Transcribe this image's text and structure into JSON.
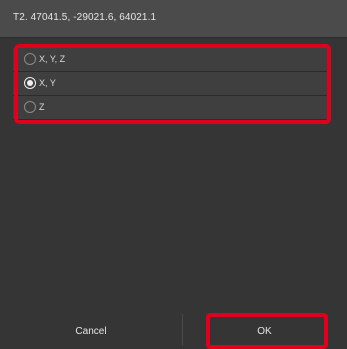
{
  "dialog": {
    "title": "T2. 47041.5, -29021.6, 64021.1"
  },
  "options": [
    {
      "label": "X, Y, Z",
      "selected": false
    },
    {
      "label": "X, Y",
      "selected": true
    },
    {
      "label": "Z",
      "selected": false
    }
  ],
  "buttons": {
    "cancel_label": "Cancel",
    "ok_label": "OK"
  },
  "colors": {
    "dialog_background": "#353535",
    "title_bar": "#4b4b4b",
    "option_row": "#3f3f3f",
    "highlight": "#e0001b",
    "text": "#e6e6e6"
  },
  "icons": {
    "radio_unchecked": "radio-unchecked-icon",
    "radio_checked": "radio-checked-icon"
  }
}
